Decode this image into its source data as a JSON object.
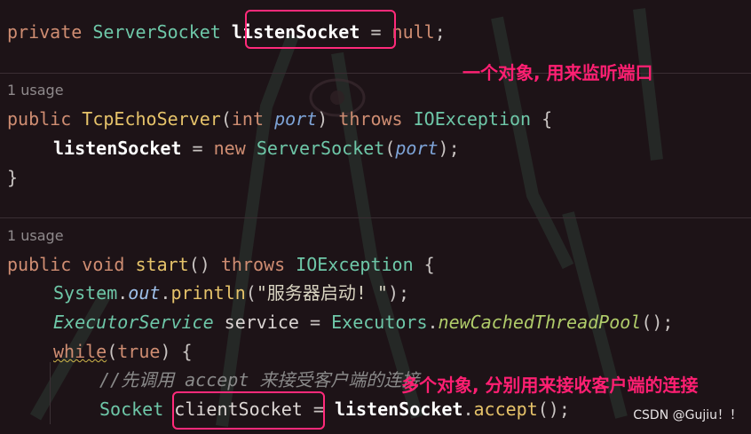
{
  "line_private": {
    "kw": "private",
    "type": "ServerSocket",
    "field": "listenSocket",
    "eq": "=",
    "null": "null",
    "semi": ";"
  },
  "usage_1": "1 usage",
  "line_ctor": {
    "kw": "public",
    "name": "TcpEchoServer",
    "paren_open": "(",
    "int": "int",
    "param": "port",
    "paren_close": ")",
    "throws": "throws",
    "exc": "IOException",
    "brace": "{"
  },
  "line_assign": {
    "field": "listenSocket",
    "eq": "=",
    "new": "new",
    "type": "ServerSocket",
    "paren_open": "(",
    "param": "port",
    "tail": ");"
  },
  "line_close1": "}",
  "usage_2": "1 usage",
  "line_start": {
    "kw": "public",
    "void": "void",
    "name": "start",
    "parens": "()",
    "throws": "throws",
    "exc": "IOException",
    "brace": "{"
  },
  "line_println": {
    "system": "System",
    "dot1": ".",
    "out": "out",
    "dot2": ".",
    "println": "println",
    "open": "(",
    "str": "\"服务器启动! \"",
    "close": ");"
  },
  "line_executor": {
    "type": "ExecutorService",
    "var": "service",
    "eq": "=",
    "cls": "Executors",
    "dot": ".",
    "method": "newCachedThreadPool",
    "tail": "();"
  },
  "line_while": {
    "kw": "while",
    "open": "(",
    "true": "true",
    "close": ")",
    "brace": "{"
  },
  "line_comment": "//先调用 accept 来接受客户端的连接",
  "line_socket": {
    "type": "Socket",
    "var": "clientSocket",
    "eq": "=",
    "field": "listenSocket",
    "dot": ".",
    "method": "accept",
    "tail": "();"
  },
  "annotations": {
    "top": "一个对象, 用来监听端口",
    "bottom": "多个对象, 分别用来接收客户端的连接"
  },
  "watermark": "CSDN @Gujiu！！",
  "colors": {
    "highlight_box": "#ff2a7a",
    "annotation": "#ff1f72",
    "background": "#1d1317"
  }
}
